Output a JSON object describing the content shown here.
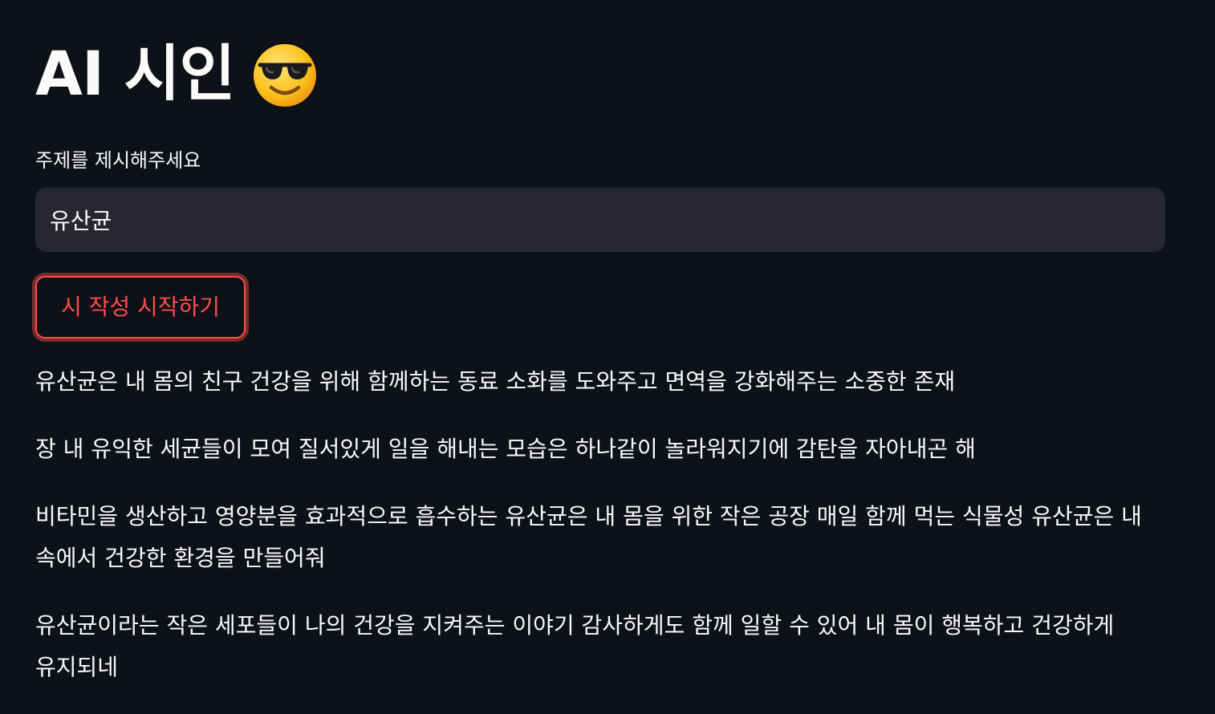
{
  "header": {
    "title": "AI 시인",
    "emoji_icon": "sunglasses-smiling-face-icon"
  },
  "topic_input": {
    "label": "주제를 제시해주세요",
    "value": "유산균"
  },
  "start_button": {
    "label": "시 작성 시작하기"
  },
  "poem": {
    "lines": [
      "유산균은 내 몸의 친구 건강을 위해 함께하는 동료 소화를 도와주고 면역을 강화해주는 소중한 존재",
      "장 내 유익한 세균들이 모여 질서있게 일을 해내는 모습은 하나같이 놀라워지기에 감탄을 자아내곤 해",
      "비타민을 생산하고 영양분을 효과적으로 흡수하는 유산균은 내 몸을 위한 작은 공장 매일 함께 먹는 식물성 유산균은 내 속에서 건강한 환경을 만들어줘",
      "유산균이라는 작은 세포들이 나의 건강을 지켜주는 이야기 감사하게도 함께 일할 수 있어 내 몸이 행복하고 건강하게 유지되네"
    ]
  },
  "colors": {
    "background": "#0e1117",
    "text": "#fafafa",
    "input_background": "#262730",
    "accent": "#ff4b4b"
  }
}
